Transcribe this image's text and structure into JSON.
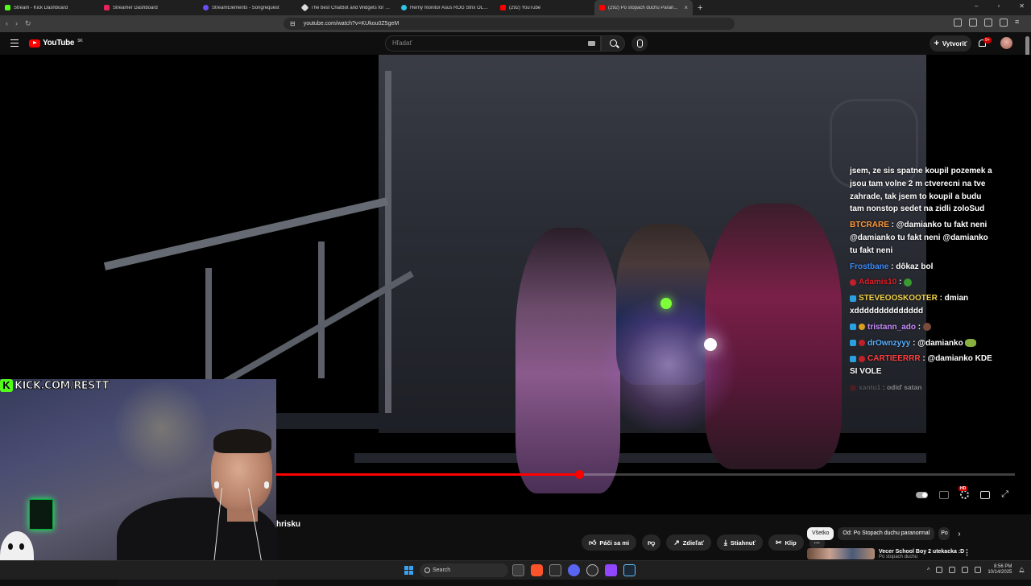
{
  "browser": {
    "tabs": [
      {
        "label": "Stream - Kick Dashboard",
        "color": "#53fc18"
      },
      {
        "label": "Streamer Dashboard",
        "color": "#e4245a"
      },
      {
        "label": "StreamElements - Songrequest",
        "color": "#6a4cf5"
      },
      {
        "label": "The best ChatBot and Widgets for K...",
        "color": "#dddddd"
      },
      {
        "label": "Herný monitor Asus ROG Strix OLED...",
        "color": "#2bc4e4"
      },
      {
        "label": "(292) YouTube",
        "color": "#ff0000"
      },
      {
        "label": "(292) Po stopach duchu Paran...",
        "color": "#ff0000",
        "active": true
      }
    ],
    "new_tab": "+",
    "url": "youtube.com/watch?v=KUkou0Z5geM"
  },
  "youtube": {
    "logo_text": "YouTube",
    "region": "SK",
    "search_placeholder": "Hľadať",
    "create_label": "Vytvoriť",
    "notifications_badge": "9+"
  },
  "stream_chat": {
    "messages": [
      {
        "user": "",
        "text": "jsem, ze sis spatne koupil pozemek a jsou tam volne 2 m ctverecni na tve zahrade, tak jsem to koupil a budu tam nonstop sedet na zidli zoloSud",
        "color": "#ffffff"
      },
      {
        "user": "BTCRARE",
        "text": ": @damianko tu fakt neni @damianko tu fakt neni @damianko tu fakt neni",
        "color": "#ff9a3c"
      },
      {
        "user": "Frostbane",
        "text": ": dôkaz bol",
        "color": "#3c8cff"
      },
      {
        "user": "Adamis10",
        "text": ":",
        "color": "#e0202a"
      },
      {
        "user": "STEVEOOSKOOTER",
        "text": ": dmian xdddddddddddddd",
        "color": "#f0d24a"
      },
      {
        "user": "tristann_ado",
        "text": ":",
        "color": "#c78cff"
      },
      {
        "user": "drOwnzyyy",
        "text": ": @damianko",
        "color": "#5ab0ff"
      },
      {
        "user": "CARTIEERRR",
        "text": ": @damianko KDE SI VOLE",
        "color": "#ff4040"
      },
      {
        "user": "xantu1",
        "text": ": odiď satan",
        "color": "#8a8a8a"
      }
    ]
  },
  "player": {
    "progress_fraction": 0.41,
    "hd_badge": "HD"
  },
  "webcam": {
    "overlay_text": "KICK.COM/RESTT",
    "kick_letter": "K"
  },
  "video_info": {
    "title_fragment": "hrisku",
    "actions": {
      "like": "Páči sa mi",
      "share": "Zdieľať",
      "download": "Stiahnuť",
      "clip": "Klip",
      "more": "···"
    }
  },
  "sidebar": {
    "chips": [
      "Všetko",
      "Od: Po Stopach duchu paranormal",
      "Po"
    ],
    "recommendation": {
      "title": "Vecer School Boy 2 utekacka :D",
      "channel": "Po stopach duchu"
    }
  },
  "taskbar": {
    "search_label": "Search",
    "time": "8:56 PM",
    "date": "10/14/2025"
  }
}
